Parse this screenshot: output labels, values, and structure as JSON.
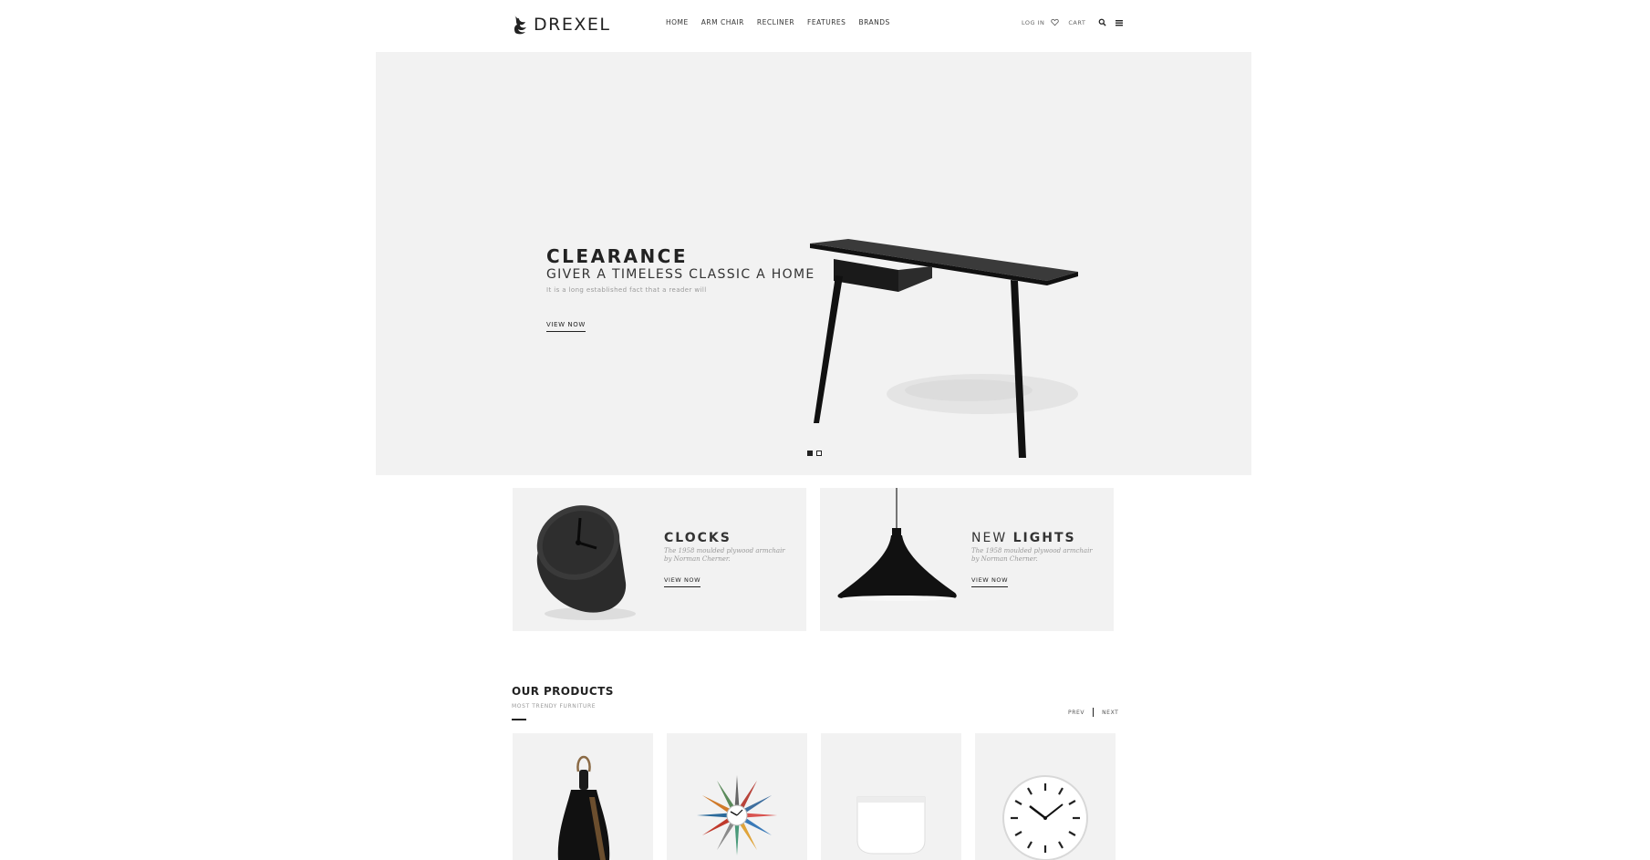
{
  "header": {
    "logo_text": "DREXEL",
    "nav": [
      "HOME",
      "ARM CHAIR",
      "RECLINER",
      "FEATURES",
      "BRANDS"
    ],
    "login_label": "LOG IN",
    "cart_label": "CART"
  },
  "hero": {
    "title": "CLEARANCE",
    "subtitle": "GIVER A TIMELESS CLASSIC A HOME",
    "description": "It is a long established fact that a reader will",
    "cta": "VIEW NOW",
    "slide_count": 2,
    "active_slide": 1
  },
  "promos": [
    {
      "title_light": "",
      "title_bold": "CLOCKS",
      "description": "The 1958 moulded plywood armchair by Norman Cherner.",
      "cta": "VIEW NOW"
    },
    {
      "title_light": "NEW ",
      "title_bold": "LIGHTS",
      "description": "The 1958 moulded plywood armchair by Norman Cherner.",
      "cta": "VIEW NOW"
    }
  ],
  "products": {
    "title": "OUR PRODUCTS",
    "subtitle": "MOST TRENDY FURNITURE",
    "prev_label": "PREV",
    "next_label": "NEXT"
  },
  "icons": {
    "logo": "bird-logo-icon",
    "wishlist": "heart-icon",
    "search": "search-icon",
    "menu": "hamburger-menu-icon"
  }
}
